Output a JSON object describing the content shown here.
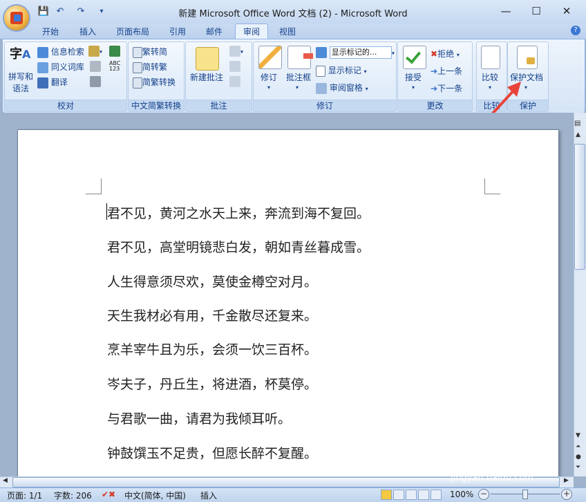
{
  "window": {
    "title": "新建 Microsoft Office Word 文档 (2) - Microsoft Word",
    "minimize": "—",
    "maximize": "☐",
    "close": "✕"
  },
  "quick_access": {
    "save_icon": "save-icon",
    "undo_icon": "undo-icon",
    "redo_icon": "redo-icon",
    "customize_icon": "customize-icon"
  },
  "tabs": [
    {
      "label": "开始",
      "active": false
    },
    {
      "label": "插入",
      "active": false
    },
    {
      "label": "页面布局",
      "active": false
    },
    {
      "label": "引用",
      "active": false
    },
    {
      "label": "邮件",
      "active": false
    },
    {
      "label": "审阅",
      "active": true
    },
    {
      "label": "视图",
      "active": false
    }
  ],
  "ribbon": {
    "proofing": {
      "label": "校对",
      "spelling": "拼写和",
      "spelling2": "语法",
      "research": "信息检索",
      "thesaurus": "同义词库",
      "translate": "翻译"
    },
    "chinese": {
      "label": "中文简繁转换",
      "to_simplified": "繁转简",
      "to_traditional": "简转繁",
      "conversion": "简繁转换"
    },
    "comments": {
      "label": "批注",
      "new_comment": "新建批注"
    },
    "tracking": {
      "label": "修订",
      "track_changes": "修订",
      "balloons": "批注框",
      "display_select": "显示标记的...",
      "show_markup": "显示标记",
      "reviewing_pane": "审阅窗格"
    },
    "changes": {
      "label": "更改",
      "accept": "接受",
      "reject": "拒绝",
      "previous": "上一条",
      "next": "下一条"
    },
    "compare": {
      "label": "比较",
      "compare": "比较"
    },
    "protect": {
      "label": "保护",
      "protect_document": "保护文档"
    }
  },
  "document": {
    "lines": [
      "君不见，黄河之水天上来，奔流到海不复回。",
      "君不见，高堂明镜悲白发，朝如青丝暮成雪。",
      "人生得意须尽欢，莫使金樽空对月。",
      "天生我材必有用，千金散尽还复来。",
      "烹羊宰牛且为乐，会须一饮三百杯。",
      "岑夫子，丹丘生，将进酒，杯莫停。",
      "与君歌一曲，请君为我倾耳听。",
      "钟鼓馔玉不足贵，但愿长醉不复醒。"
    ]
  },
  "status": {
    "page": "页面: 1/1",
    "words": "字数: 206",
    "language": "中文(简体, 中国)",
    "mode": "插入",
    "zoom": "100%"
  },
  "watermark": {
    "brand": "Baidu经验",
    "url": "jingyan.baidu.com"
  },
  "colors": {
    "accent": "#15428b",
    "ribbon": "#dbe8f8",
    "arrow": "#e8443a"
  }
}
